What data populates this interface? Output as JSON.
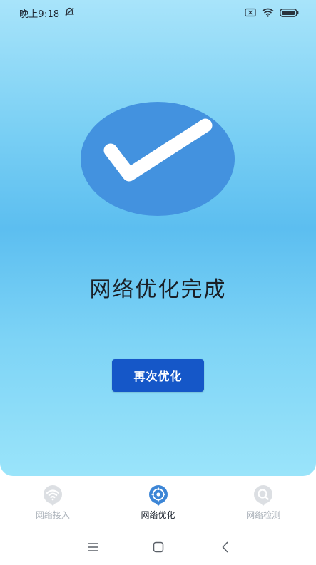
{
  "status_bar": {
    "time": "晚上9:18",
    "icons": [
      "alarm-off-icon",
      "sim-off-icon",
      "wifi-icon",
      "battery-icon"
    ]
  },
  "result": {
    "icon": "checkmark-icon",
    "title": "网络优化完成"
  },
  "retry_button": {
    "label": "再次优化"
  },
  "tabs": [
    {
      "label": "网络接入",
      "icon": "wifi-tab-icon",
      "active": false
    },
    {
      "label": "网络优化",
      "icon": "optimize-tab-icon",
      "active": true
    },
    {
      "label": "网络检测",
      "icon": "search-tab-icon",
      "active": false
    }
  ],
  "system_nav": [
    "menu-icon",
    "home-icon",
    "back-icon"
  ],
  "colors": {
    "accent": "#1557c8",
    "check_circle": "#4392df",
    "inactive_tab": "#a9b0b8"
  }
}
